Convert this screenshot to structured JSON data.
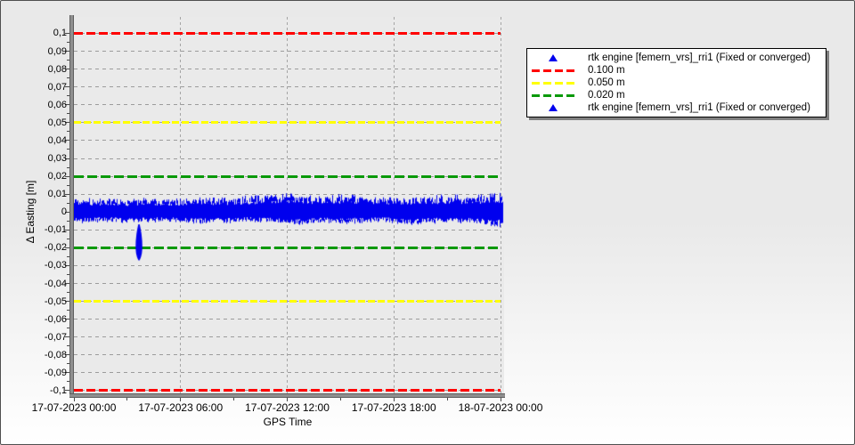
{
  "chart_data": {
    "type": "scatter",
    "title": "",
    "xlabel": "GPS Time",
    "ylabel": "Δ Easting [m]",
    "x_ticks": [
      "17-07-2023 00:00",
      "17-07-2023 06:00",
      "17-07-2023 12:00",
      "17-07-2023 18:00",
      "18-07-2023 00:00"
    ],
    "x_tick_hours": [
      0,
      6,
      12,
      18,
      24
    ],
    "x_minor_tick_hours": [
      3,
      9,
      15,
      21
    ],
    "x_range_hours": [
      0,
      24.1
    ],
    "y_ticks": [
      "0,1",
      "0,09",
      "0,08",
      "0,07",
      "0,06",
      "0,05",
      "0,04",
      "0,03",
      "0,02",
      "0,01",
      "0",
      "-0,01",
      "-0,02",
      "-0,03",
      "-0,04",
      "-0,05",
      "-0,06",
      "-0,07",
      "-0,08",
      "-0,09",
      "-0,1"
    ],
    "y_tick_values": [
      0.1,
      0.09,
      0.08,
      0.07,
      0.06,
      0.05,
      0.04,
      0.03,
      0.02,
      0.01,
      0,
      -0.01,
      -0.02,
      -0.03,
      -0.04,
      -0.05,
      -0.06,
      -0.07,
      -0.08,
      -0.09,
      -0.1
    ],
    "y_range": [
      -0.1015,
      0.1092
    ],
    "grid": {
      "horizontal_step": 0.01,
      "vertical_step_hours": 6,
      "style": "dashed"
    },
    "reference_lines": [
      {
        "label": "0.100 m",
        "value": 0.1,
        "color": "#ff0000",
        "style": "dashed"
      },
      {
        "label": "0.100 m",
        "value": -0.1,
        "color": "#ff0000",
        "style": "dashed"
      },
      {
        "label": "0.050 m",
        "value": 0.05,
        "color": "#ffff00",
        "style": "dashed"
      },
      {
        "label": "0.050 m",
        "value": -0.05,
        "color": "#ffff00",
        "style": "dashed"
      },
      {
        "label": "0.020 m",
        "value": 0.02,
        "color": "#089908",
        "style": "dashed"
      },
      {
        "label": "0.020 m",
        "value": -0.02,
        "color": "#089908",
        "style": "dashed"
      }
    ],
    "series": [
      {
        "name": "rtk engine [femern_vrs]_rri1 (Fixed or converged)",
        "color": "#0000ee",
        "marker": "triangle",
        "description": "Dense noise band of Δ Easting centered on 0 m, roughly ±0.005 to ±0.008 m, for 17-07-2023 00:00 to 18-07-2023 00:00",
        "band_envelope": [
          [
            0,
            -0.005,
            0.0065
          ],
          [
            1,
            -0.0048,
            0.006
          ],
          [
            2,
            -0.0045,
            0.0058
          ],
          [
            3,
            -0.005,
            0.0055
          ],
          [
            4,
            -0.005,
            0.006
          ],
          [
            5,
            -0.0045,
            0.0055
          ],
          [
            6,
            -0.005,
            0.006
          ],
          [
            7,
            -0.0055,
            0.0065
          ],
          [
            8,
            -0.005,
            0.006
          ],
          [
            9,
            -0.005,
            0.0065
          ],
          [
            10,
            -0.0045,
            0.007
          ],
          [
            11,
            -0.005,
            0.0075
          ],
          [
            12,
            -0.0055,
            0.008
          ],
          [
            13,
            -0.006,
            0.0075
          ],
          [
            14,
            -0.005,
            0.007
          ],
          [
            15,
            -0.0055,
            0.0075
          ],
          [
            16,
            -0.005,
            0.007
          ],
          [
            17,
            -0.0045,
            0.0065
          ],
          [
            18,
            -0.005,
            0.006
          ],
          [
            19,
            -0.0065,
            0.0065
          ],
          [
            20,
            -0.005,
            0.007
          ],
          [
            21,
            -0.0055,
            0.0075
          ],
          [
            22,
            -0.005,
            0.007
          ],
          [
            23,
            -0.006,
            0.0075
          ],
          [
            24,
            -0.007,
            0.008
          ],
          [
            24.1,
            -0.007,
            0.008
          ]
        ],
        "anomaly": {
          "t_hours": 3.66,
          "v_top": -0.0065,
          "v_bottom": -0.0268,
          "note": "brief downward excursion reaching about -0.026 m just below the -0.020 m limit line"
        }
      }
    ],
    "legend": {
      "position": "right-top",
      "entries": [
        {
          "symbol": "triangle",
          "color": "#0000ee",
          "label": "rtk engine [femern_vrs]_rri1 (Fixed or converged)"
        },
        {
          "symbol": "dash",
          "color": "#ff0000",
          "label": "0.100 m"
        },
        {
          "symbol": "dash",
          "color": "#ffff00",
          "label": "0.050 m"
        },
        {
          "symbol": "dash",
          "color": "#089908",
          "label": "0.020 m"
        },
        {
          "symbol": "triangle",
          "color": "#0000ee",
          "label": "rtk engine [femern_vrs]_rri1 (Fixed or converged)"
        }
      ]
    }
  },
  "colors": {
    "background_top": "#e9e9e9",
    "background_bottom": "#ffffff",
    "plot_background": "#eaeaea",
    "grid": "#9c9c9c",
    "axis": "#8f8f8f",
    "series_blue": "#0000ee",
    "ref_red": "#ff0000",
    "ref_yellow": "#ffff00",
    "ref_green": "#089908",
    "legend_background": "#ffffff",
    "legend_border": "#000000"
  }
}
